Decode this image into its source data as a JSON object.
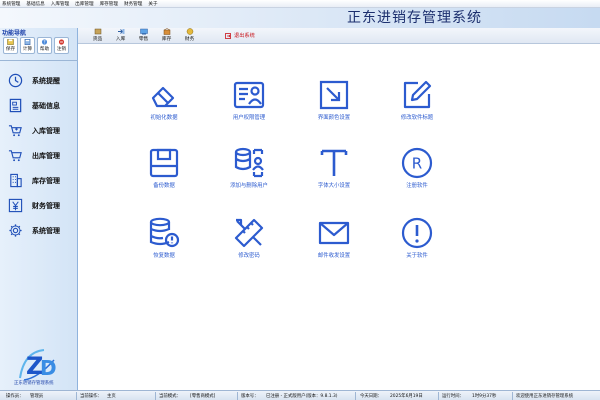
{
  "menubar": [
    "系统管理",
    "基础信息",
    "入库管理",
    "出库管理",
    "库存管理",
    "财务管理",
    "关于"
  ],
  "app_title": "正东进销存管理系统",
  "left_panel": {
    "header": "功能导航",
    "quick_buttons": [
      "保存",
      "计算",
      "帮助",
      "注销"
    ],
    "nav_items": [
      "系统提醒",
      "基础信息",
      "入库管理",
      "出库管理",
      "库存管理",
      "财务管理",
      "系统管理"
    ],
    "logo_caption": "正东进销存管理系统"
  },
  "toolbar": {
    "items": [
      "货品",
      "入库",
      "零售",
      "库存",
      "财务"
    ],
    "exit_label": "退出系统"
  },
  "tiles": [
    {
      "label": "初始化数据",
      "icon": "eraser-icon"
    },
    {
      "label": "用户权限管理",
      "icon": "user-permission-icon"
    },
    {
      "label": "界面颜色设置",
      "icon": "resize-window-icon"
    },
    {
      "label": "修改软件标题",
      "icon": "edit-icon"
    },
    {
      "label": "备份数据",
      "icon": "save-disk-icon"
    },
    {
      "label": "添加与删除用户",
      "icon": "database-user-icon"
    },
    {
      "label": "字体大小设置",
      "icon": "font-icon"
    },
    {
      "label": "注册软件",
      "icon": "registered-icon"
    },
    {
      "label": "恢复数据",
      "icon": "database-alert-icon"
    },
    {
      "label": "修改密码",
      "icon": "tools-icon"
    },
    {
      "label": "邮件收发设置",
      "icon": "mail-icon"
    },
    {
      "label": "关于软件",
      "icon": "info-icon"
    }
  ],
  "statusbar": {
    "operator_label": "操作员：",
    "operator": "管理员",
    "current_op_label": "当前操作：",
    "current_op": "主页",
    "mode_label": "当前模式：",
    "mode": "[零售商模式]",
    "version_label": "版本号：",
    "version": "已注册 - 正式版用户(版本：9.8.1.3)",
    "date_label": "今天日期：",
    "date": "2025年6月19日",
    "runtime_label": "运行时间：",
    "runtime": "1时9分37秒",
    "welcome": "欢迎使用正东进销存管理系统"
  },
  "colors": {
    "accent": "#2c5bcf",
    "icon": "#2c5bcf",
    "exit": "#c8151b"
  }
}
